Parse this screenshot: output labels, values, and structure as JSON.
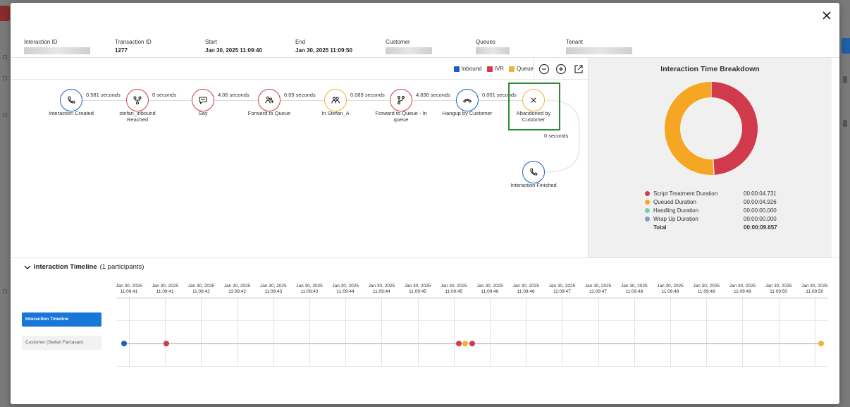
{
  "header": {
    "fields": [
      {
        "label": "Interaction ID",
        "value": "",
        "redacted": true
      },
      {
        "label": "Transaction ID",
        "value": "1277",
        "redacted": false
      },
      {
        "label": "Start",
        "value": "Jan 30, 2025 11:09:40",
        "redacted": false
      },
      {
        "label": "End",
        "value": "Jan 30, 2025 11:09:50",
        "redacted": false
      },
      {
        "label": "Customer",
        "value": "",
        "redacted": true
      },
      {
        "label": "Queues",
        "value": "",
        "redacted": true
      },
      {
        "label": "Tenant",
        "value": "",
        "redacted": true
      }
    ]
  },
  "legend": [
    {
      "label": "Inbound",
      "color": "#1a5fc8"
    },
    {
      "label": "IVR",
      "color": "#d13a4a"
    },
    {
      "label": "Queue",
      "color": "#f2b233"
    }
  ],
  "flow": {
    "nodes": [
      {
        "label": "Interaction Created",
        "type": "inbound",
        "icon": "phone-icon"
      },
      {
        "label": "stefan_inbound Reached",
        "type": "ivr",
        "icon": "flow-icon"
      },
      {
        "label": "Say",
        "type": "ivr",
        "icon": "speech-bubble-icon"
      },
      {
        "label": "Forward to Queue",
        "type": "ivr",
        "icon": "people-forward-icon"
      },
      {
        "label": "In Stefan_A",
        "type": "queue",
        "icon": "people-icon"
      },
      {
        "label": "Forward to Queue - In queue",
        "type": "ivr",
        "icon": "branch-icon"
      },
      {
        "label": "Hangup by Customer",
        "type": "inbound",
        "icon": "hangup-icon"
      },
      {
        "label": "Abandoned by Customer",
        "type": "queue",
        "icon": "x-icon"
      },
      {
        "label": "Interaction Finished",
        "type": "inbound",
        "icon": "phone-icon"
      }
    ],
    "edges": [
      "0.581 seconds",
      "0 seconds",
      "4.06 seconds",
      "0.09 seconds",
      "0.089 seconds",
      "4.836 seconds",
      "0.001 seconds",
      "0 seconds"
    ]
  },
  "breakdown": {
    "title": "Interaction Time Breakdown",
    "rows": [
      {
        "name": "Script Treatment Duration",
        "value": "00:00:04.731",
        "color": "#d13a4a"
      },
      {
        "name": "Queued Duration",
        "value": "00:00:04.926",
        "color": "#f5a623"
      },
      {
        "name": "Handling Duration",
        "value": "00:00:00.000",
        "color": "#6fd3a2"
      },
      {
        "name": "Wrap Up Duration",
        "value": "00:00:00.000",
        "color": "#7a9ecf"
      }
    ],
    "total_label": "Total",
    "total_value": "00:00:09.657"
  },
  "timeline": {
    "title": "Interaction Timeline",
    "subtitle": "(1 participants)",
    "rows": [
      "Interaction Timeline",
      "Customer (Stefan Farcasan)"
    ],
    "ticks": [
      [
        "Jan 30, 2025",
        "11:09:41"
      ],
      [
        "Jan 30, 2025",
        "11:09:41"
      ],
      [
        "Jan 30, 2025",
        "11:09:42"
      ],
      [
        "Jan 30, 2025",
        "11:09:42"
      ],
      [
        "Jan 30, 2025",
        "11:09:43"
      ],
      [
        "Jan 30, 2025",
        "11:09:43"
      ],
      [
        "Jan 30, 2025",
        "11:09:44"
      ],
      [
        "Jan 30, 2025",
        "11:09:44"
      ],
      [
        "Jan 30, 2025",
        "11:09:45"
      ],
      [
        "Jan 30, 2025",
        "11:09:45"
      ],
      [
        "Jan 30, 2025",
        "11:09:46"
      ],
      [
        "Jan 30, 2025",
        "11:09:46"
      ],
      [
        "Jan 30, 2025",
        "11:09:47"
      ],
      [
        "Jan 30, 2025",
        "11:09:47"
      ],
      [
        "Jan 30, 2025",
        "11:09:48"
      ],
      [
        "Jan 30, 2025",
        "11:09:48"
      ],
      [
        "Jan 30, 2025",
        "11:09:49"
      ],
      [
        "Jan 30, 2025",
        "11:09:49"
      ],
      [
        "Jan 30, 2025",
        "11:09:50"
      ],
      [
        "Jan 30, 2025",
        "11:09:50"
      ]
    ],
    "events": [
      {
        "color": "#1a5fc8",
        "t": 0.0
      },
      {
        "color": "#d13a4a",
        "t": 0.581
      },
      {
        "color": "#d13a4a",
        "t": 4.64
      },
      {
        "color": "#f2b233",
        "t": 4.73
      },
      {
        "color": "#d13a4a",
        "t": 4.82
      },
      {
        "color": "#f2b233",
        "t": 9.657
      }
    ]
  }
}
